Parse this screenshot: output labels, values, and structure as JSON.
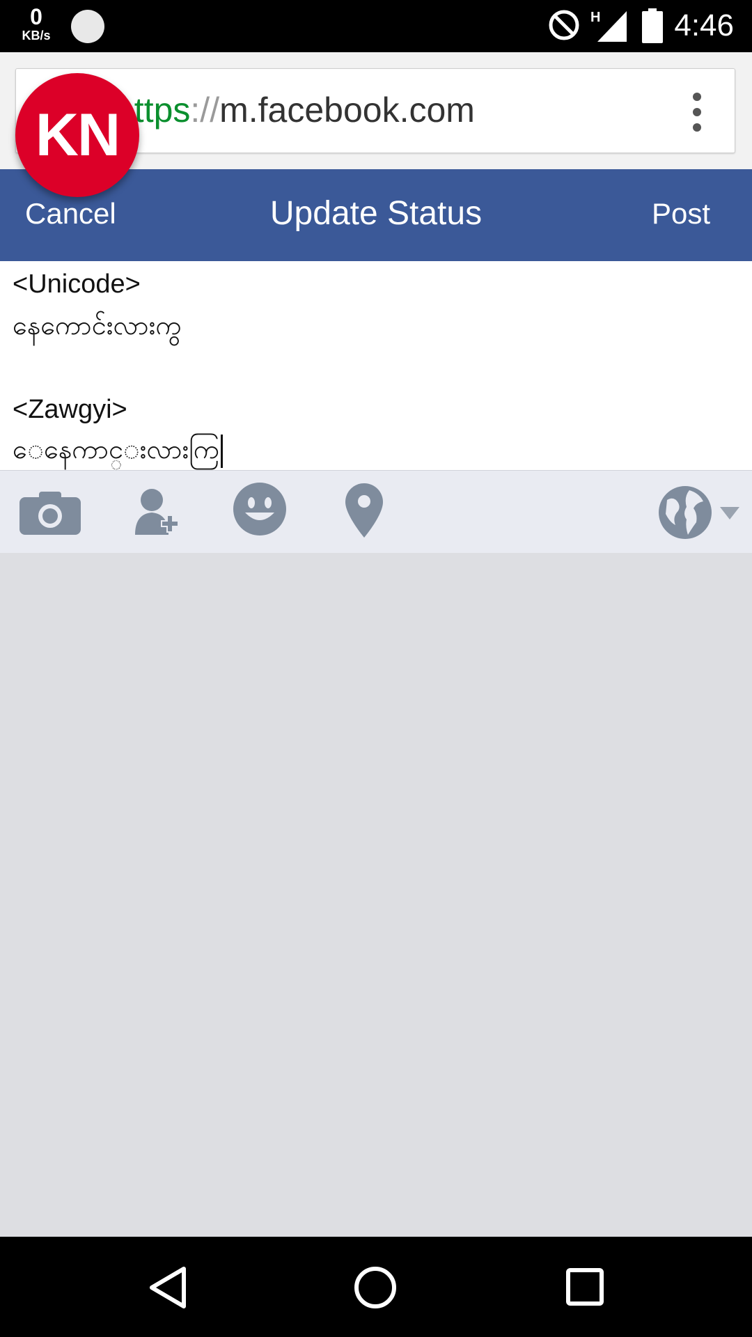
{
  "status_bar": {
    "net_speed_value": "0",
    "net_speed_unit": "KB/s",
    "network_type": "H",
    "time": "4:46"
  },
  "browser": {
    "url_scheme": "https",
    "url_separator": "://",
    "url_host": "m.facebook.com"
  },
  "overlay": {
    "bubble_label": "KN",
    "bubble_color": "#dc0028"
  },
  "header": {
    "cancel_label": "Cancel",
    "title": "Update Status",
    "post_label": "Post",
    "color": "#3b5998"
  },
  "composer": {
    "lines": [
      "<Unicode>",
      "နေကောင်းလားကွ",
      "<Zawgyi>",
      "ေနေကာင္းလားကြ"
    ]
  },
  "toolbar": {
    "icons": [
      "camera-icon",
      "tag-friend-icon",
      "emoji-icon",
      "location-icon",
      "audience-globe-icon"
    ]
  }
}
